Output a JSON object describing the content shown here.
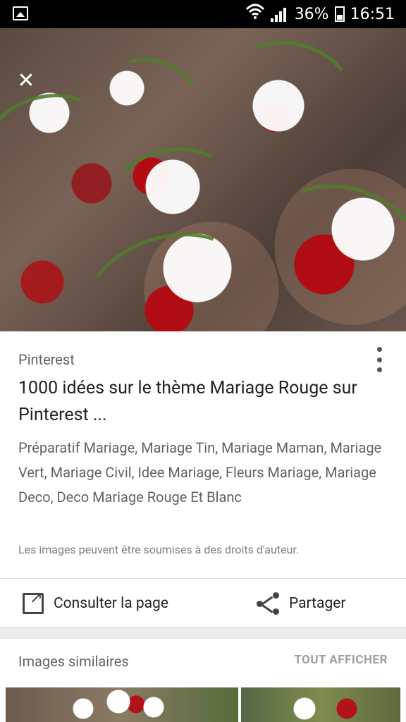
{
  "status_bar": {
    "battery_percent": "36%",
    "time": "16:51",
    "icons": [
      "image-icon",
      "wifi-icon",
      "signal-icon",
      "battery-icon"
    ]
  },
  "viewer": {
    "close_icon": "close-icon"
  },
  "card": {
    "source": "Pinterest",
    "title": "1000 idées sur le thème Mariage Rouge sur Pinterest ...",
    "description": "Préparatif Mariage, Mariage Tin, Mariage Maman, Mariage Vert, Mariage Civil, Idee Mariage, Fleurs Mariage, Mariage Deco, Deco Mariage Rouge Et Blanc",
    "copyright": "Les images peuvent être soumises à des droits d'auteur.",
    "actions": {
      "consult": "Consulter la page",
      "share": "Partager"
    }
  },
  "similar_images": {
    "title": "Images similaires",
    "see_all": "TOUT AFFICHER"
  },
  "colors": {
    "accent_red": "#b4121a",
    "text_primary": "#202124",
    "text_secondary": "#5f6368"
  }
}
